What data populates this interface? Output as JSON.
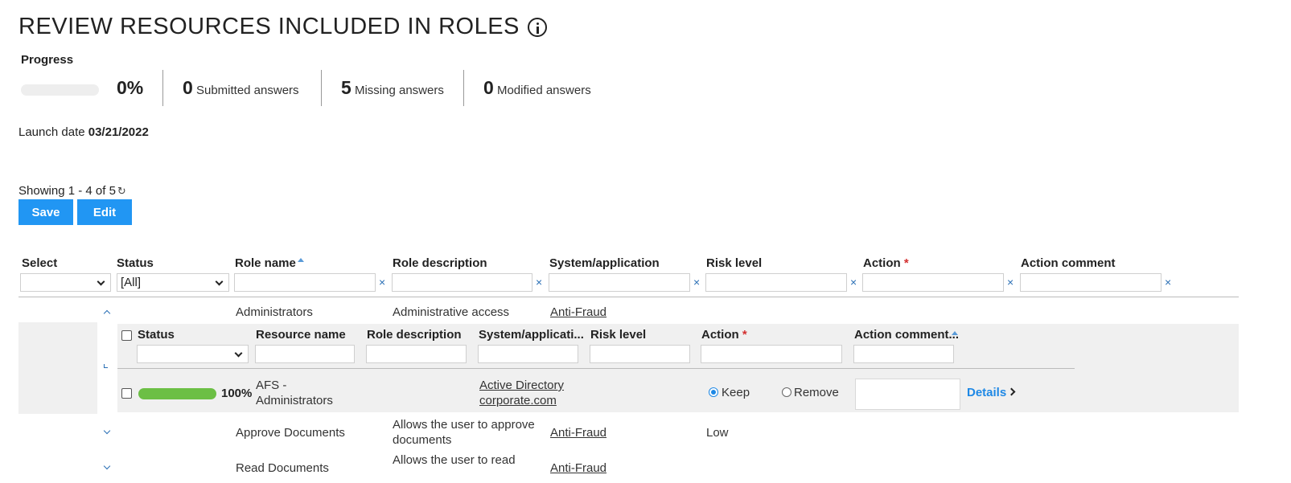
{
  "page": {
    "title": "REVIEW RESOURCES INCLUDED IN ROLES",
    "progress_label": "Progress",
    "progress": {
      "percent_text": "0%",
      "fraction": 0
    },
    "stats": [
      {
        "value": "0",
        "label": "Submitted answers"
      },
      {
        "value": "5",
        "label": "Missing answers"
      },
      {
        "value": "0",
        "label": "Modified answers"
      }
    ],
    "launch_label": "Launch date",
    "launch_date": "03/21/2022",
    "showing": "Showing 1 - 4 of 5",
    "buttons": {
      "save": "Save",
      "edit": "Edit"
    }
  },
  "table": {
    "headers": {
      "select": "Select",
      "status": "Status",
      "role_name": "Role name",
      "role_description": "Role description",
      "system": "System/application",
      "risk": "Risk level",
      "action": "Action",
      "action_required": "*",
      "action_comment": "Action comment"
    },
    "filters": {
      "status_value": "[All]",
      "clear_symbol": "×"
    },
    "rows": [
      {
        "role_name": "Administrators",
        "role_description": "Administrative access",
        "system": "Anti-Fraud",
        "risk": ""
      },
      {
        "role_name": "Approve Documents",
        "role_description_l1": "Allows the user to approve",
        "role_description_l2": "documents",
        "system": "Anti-Fraud",
        "risk": "Low"
      },
      {
        "role_name": "Read Documents",
        "role_description_l1": "Allows the user to read",
        "system": "Anti-Fraud",
        "risk": ""
      }
    ]
  },
  "subtable": {
    "headers": {
      "status": "Status",
      "resource_name": "Resource name",
      "role_description": "Role description",
      "system": "System/applicati...",
      "risk": "Risk level",
      "action": "Action",
      "action_required": "*",
      "action_comment": "Action comment..."
    },
    "row": {
      "progress_text": "100%",
      "progress_fraction": 1,
      "resource_l1": "AFS -",
      "resource_l2": "Administrators",
      "system_l1": "Active Directory",
      "system_l2": "corporate.com",
      "keep": "Keep",
      "remove": "Remove",
      "selected_action": "Keep",
      "details": "Details"
    }
  }
}
